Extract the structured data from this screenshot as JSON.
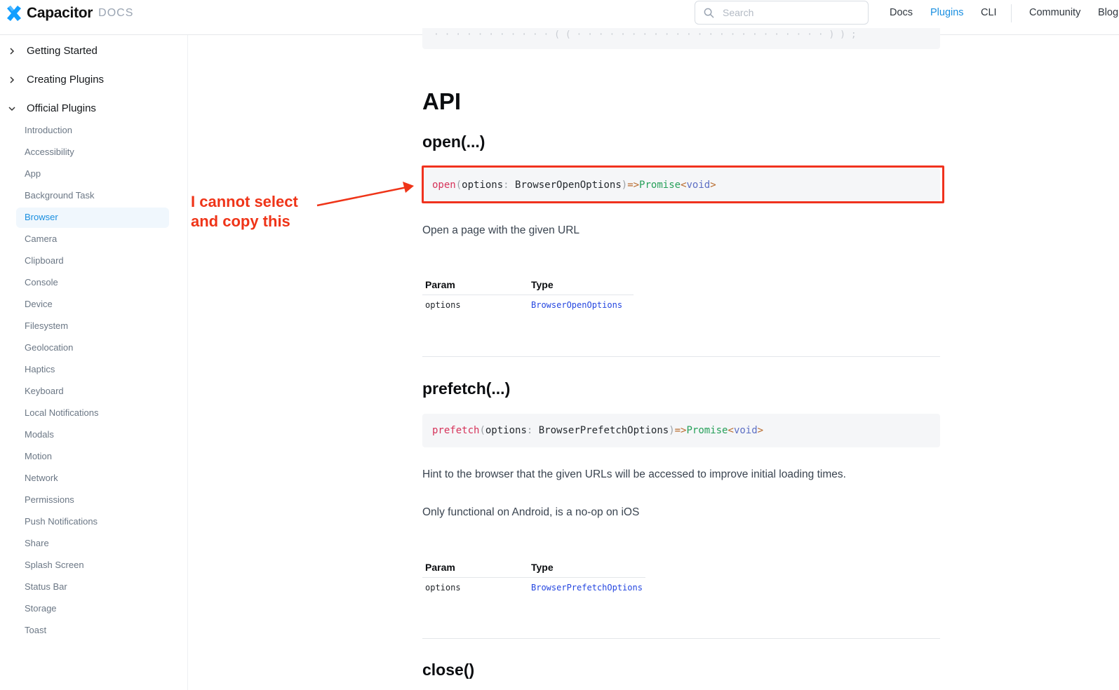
{
  "header": {
    "logo_text": "Capacitor",
    "logo_suffix": "DOCS",
    "search_placeholder": "Search",
    "nav": [
      "Docs",
      "Plugins",
      "CLI",
      "Community",
      "Blog"
    ],
    "active_nav": "Plugins",
    "accent_color": "#1a8fe0"
  },
  "sidebar": {
    "sections": [
      {
        "label": "Getting Started",
        "expanded": false,
        "icon": "chevron-right-icon"
      },
      {
        "label": "Creating Plugins",
        "expanded": false,
        "icon": "chevron-right-icon"
      },
      {
        "label": "Official Plugins",
        "expanded": true,
        "icon": "chevron-down-icon"
      }
    ],
    "items": [
      "Introduction",
      "Accessibility",
      "App",
      "Background Task",
      "Browser",
      "Camera",
      "Clipboard",
      "Console",
      "Device",
      "Filesystem",
      "Geolocation",
      "Haptics",
      "Keyboard",
      "Local Notifications",
      "Modals",
      "Motion",
      "Network",
      "Permissions",
      "Push Notifications",
      "Share",
      "Splash Screen",
      "Status Bar",
      "Storage",
      "Toast"
    ],
    "active_item": "Browser"
  },
  "content": {
    "api_heading": "API",
    "open": {
      "heading": "open(...)",
      "sig": {
        "fn": "open",
        "lp": "(",
        "param": "options",
        "colon": ": ",
        "type": "BrowserOpenOptions",
        "rp": ")",
        "arrow": "=>",
        "ret": "Promise",
        "lt": "<",
        "void": "void",
        "gt": ">"
      },
      "description": "Open a page with the given URL",
      "table": {
        "headers": [
          "Param",
          "Type"
        ],
        "rows": [
          [
            "options",
            "BrowserOpenOptions"
          ]
        ]
      }
    },
    "prefetch": {
      "heading": "prefetch(...)",
      "sig": {
        "fn": "prefetch",
        "lp": "(",
        "param": "options",
        "colon": ": ",
        "type": "BrowserPrefetchOptions",
        "rp": ")",
        "arrow": "=>",
        "ret": "Promise",
        "lt": "<",
        "void": "void",
        "gt": ">"
      },
      "description": "Hint to the browser that the given URLs will be accessed to improve initial loading times.",
      "note": "Only functional on Android, is a no-op on iOS",
      "table": {
        "headers": [
          "Param",
          "Type"
        ],
        "rows": [
          [
            "options",
            "BrowserPrefetchOptions"
          ]
        ]
      }
    },
    "close": {
      "heading": "close()"
    }
  },
  "annotation": {
    "text": "I cannot select\nand copy this",
    "color": "#ef3418"
  }
}
